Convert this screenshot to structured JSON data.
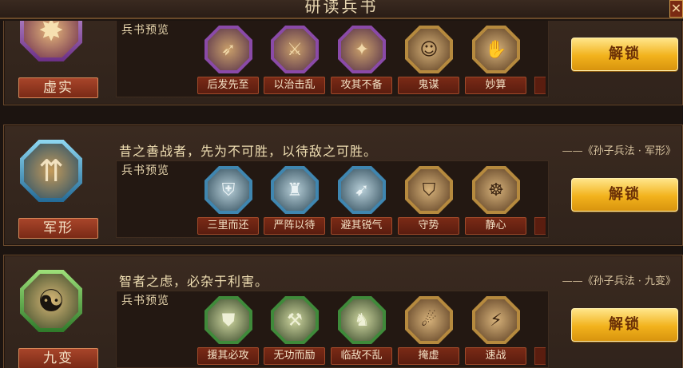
{
  "window": {
    "title": "研读兵书",
    "close_icon": "✕"
  },
  "common": {
    "preview_label": "兵书预览",
    "unlock_label": "解锁"
  },
  "books": [
    {
      "name": "虚实",
      "emblem_glyph": "✸",
      "quote": "",
      "source": "",
      "skills": [
        {
          "name": "后发先至",
          "glyph": "➶",
          "rarity": "purple"
        },
        {
          "name": "以治击乱",
          "glyph": "⚔",
          "rarity": "purple"
        },
        {
          "name": "攻其不备",
          "glyph": "✦",
          "rarity": "purple"
        },
        {
          "name": "鬼谋",
          "glyph": "☺",
          "rarity": "gold"
        },
        {
          "name": "妙算",
          "glyph": "✋",
          "rarity": "gold"
        }
      ]
    },
    {
      "name": "军形",
      "emblem_glyph": "⇈",
      "quote": "昔之善战者，先为不可胜，以待敌之可胜。",
      "source": "——《孙子兵法 · 军形》",
      "skills": [
        {
          "name": "三里而还",
          "glyph": "⛨",
          "rarity": "blue"
        },
        {
          "name": "严阵以待",
          "glyph": "♜",
          "rarity": "blue"
        },
        {
          "name": "避其锐气",
          "glyph": "➹",
          "rarity": "blue"
        },
        {
          "name": "守势",
          "glyph": "⛉",
          "rarity": "gold"
        },
        {
          "name": "静心",
          "glyph": "☸",
          "rarity": "gold"
        }
      ]
    },
    {
      "name": "九变",
      "emblem_glyph": "☯",
      "quote": "智者之虑，必杂于利害。",
      "source": "——《孙子兵法 · 九变》",
      "skills": [
        {
          "name": "援其必攻",
          "glyph": "⛊",
          "rarity": "green"
        },
        {
          "name": "无功而励",
          "glyph": "⚒",
          "rarity": "green"
        },
        {
          "name": "临敌不乱",
          "glyph": "♞",
          "rarity": "green"
        },
        {
          "name": "掩虚",
          "glyph": "☄",
          "rarity": "gold"
        },
        {
          "name": "速战",
          "glyph": "⚡",
          "rarity": "gold"
        }
      ]
    }
  ]
}
